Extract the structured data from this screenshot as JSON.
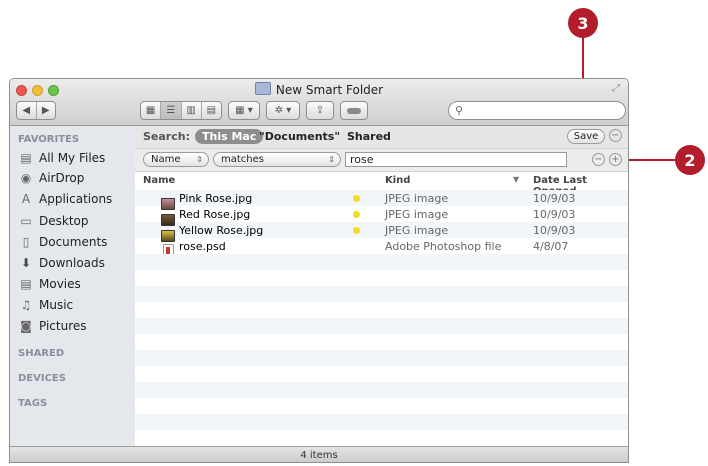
{
  "window": {
    "title": "New Smart Folder"
  },
  "search": {
    "placeholder": ""
  },
  "scope_bar": {
    "label": "Search:",
    "this_mac": "This Mac",
    "documents": "\"Documents\"",
    "shared": "Shared",
    "save_label": "Save"
  },
  "criteria": {
    "attribute": "Name",
    "operator": "matches",
    "value": "rose"
  },
  "sidebar": {
    "favorites_header": "FAVORITES",
    "items": [
      {
        "label": "All My Files",
        "icon": "all-files-icon"
      },
      {
        "label": "AirDrop",
        "icon": "airdrop-icon"
      },
      {
        "label": "Applications",
        "icon": "applications-icon"
      },
      {
        "label": "Desktop",
        "icon": "desktop-icon"
      },
      {
        "label": "Documents",
        "icon": "documents-icon"
      },
      {
        "label": "Downloads",
        "icon": "downloads-icon"
      },
      {
        "label": "Movies",
        "icon": "movies-icon"
      },
      {
        "label": "Music",
        "icon": "music-icon"
      },
      {
        "label": "Pictures",
        "icon": "pictures-icon"
      }
    ],
    "shared_header": "SHARED",
    "devices_header": "DEVICES",
    "tags_header": "TAGS"
  },
  "columns": {
    "name": "Name",
    "kind": "Kind",
    "date": "Date Last Opened"
  },
  "files": [
    {
      "name": "Pink Rose.jpg",
      "kind": "JPEG image",
      "date": "10/9/03",
      "tag": "yellow"
    },
    {
      "name": "Red Rose.jpg",
      "kind": "JPEG image",
      "date": "10/9/03",
      "tag": "yellow"
    },
    {
      "name": "Yellow Rose.jpg",
      "kind": "JPEG image",
      "date": "10/9/03",
      "tag": "yellow"
    },
    {
      "name": "rose.psd",
      "kind": "Adobe Photoshop file",
      "date": "4/8/07",
      "tag": ""
    }
  ],
  "status": {
    "items": "4 items"
  },
  "callouts": {
    "save": "3",
    "add_criteria": "2"
  },
  "colors": {
    "callout": "#b31d2b",
    "tag_yellow": "#f1dd24",
    "sidebar_bg": "#e4e7ec",
    "scope_selected": "#8d8d8d"
  }
}
